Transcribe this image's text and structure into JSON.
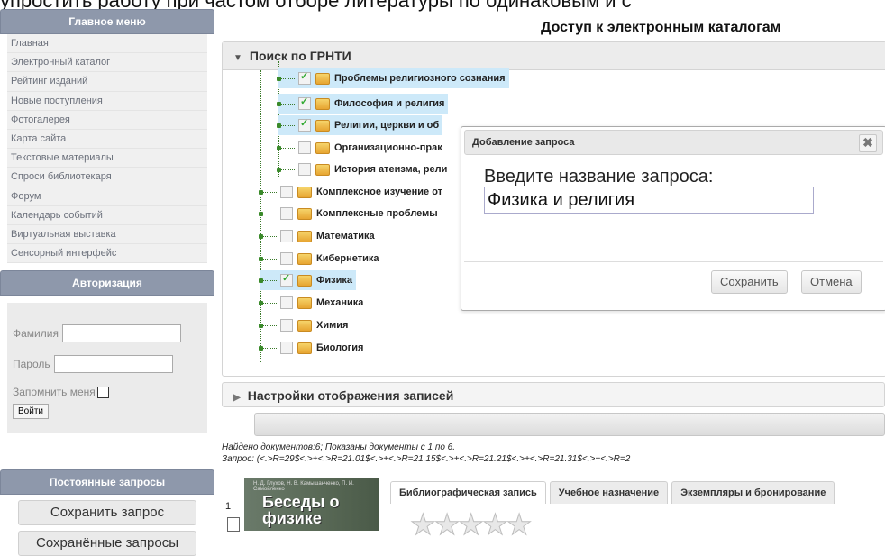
{
  "page_top_text": "упростить работу при частом отборе литературы по одинаковым и с",
  "sidebar": {
    "main_menu_title": "Главное меню",
    "menu_items": [
      "Главная",
      "Электронный каталог",
      "Рейтинг изданий",
      "Новые поступления",
      "Фотогалерея",
      "Карта сайта",
      "Текстовые материалы",
      "Спроси библиотекаря",
      "Форум",
      "Календарь событий",
      "Виртуальная выставка",
      "Сенсорный интерфейс"
    ],
    "auth_title": "Авторизация",
    "surname_label": "Фамилия",
    "password_label": "Пароль",
    "remember_label": "Запомнить меня",
    "login_button": "Войти",
    "queries_title": "Постоянные запросы",
    "save_query_button": "Сохранить запрос",
    "saved_queries_button": "Сохранённые запросы"
  },
  "main": {
    "title": "Доступ к электронным каталогам",
    "grnti_section": "Поиск по ГРНТИ",
    "tree": [
      {
        "label": "Проблемы религиозного сознания",
        "checked": true,
        "level": 2
      },
      {
        "label": "Философия и религия",
        "checked": true,
        "level": 2
      },
      {
        "label": "Религии, церкви и об",
        "checked": true,
        "level": 2
      },
      {
        "label": "Организационно-прак",
        "checked": false,
        "level": 2
      },
      {
        "label": "История атеизма, рели",
        "checked": false,
        "level": 2
      },
      {
        "label": "Комплексное изучение от",
        "checked": false,
        "level": 1
      },
      {
        "label": "Комплексные проблемы",
        "checked": false,
        "level": 1
      },
      {
        "label": "Математика",
        "checked": false,
        "level": 1
      },
      {
        "label": "Кибернетика",
        "checked": false,
        "level": 1
      },
      {
        "label": "Физика",
        "checked": true,
        "level": 1
      },
      {
        "label": "Механика",
        "checked": false,
        "level": 1
      },
      {
        "label": "Химия",
        "checked": false,
        "level": 1
      },
      {
        "label": "Биология",
        "checked": false,
        "level": 1
      }
    ],
    "display_settings_section": "Настройки отображения записей",
    "found_text": "Найдено документов:6; Показаны документы с 1 по 6.",
    "query_text": "Запрос: (<.>R=29$<.>+<.>R=21.01$<.>+<.>R=21.15$<.>+<.>R=21.21$<.>+<.>R=21.31$<.>+<.>R=2",
    "record_number": "1",
    "book_cover_title": "Беседы о физике",
    "book_cover_authors": "Н. Д. Глухов, Н. В. Камышанченко, П. И. Самойленко",
    "tabs": [
      "Библиографическая запись",
      "Учебное назначение",
      "Экземпляры и бронирование"
    ],
    "rating_stars": "★★★★★"
  },
  "dialog": {
    "title": "Добавление запроса",
    "close_glyph": "✖",
    "prompt": "Введите название запроса:",
    "input_value": "Физика и религия",
    "save_button": "Сохранить",
    "cancel_button": "Отмена"
  }
}
